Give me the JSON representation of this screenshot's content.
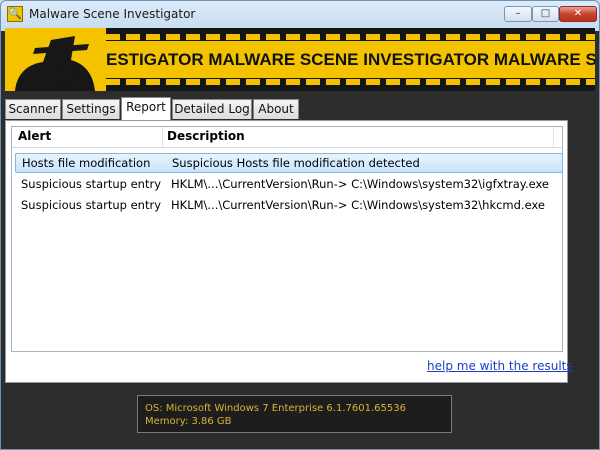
{
  "window": {
    "title": "Malware Scene Investigator",
    "icon": "magnifier-app-icon",
    "controls": {
      "minimize": "–",
      "maximize": "□",
      "close": "✕"
    }
  },
  "banner": {
    "text": "ESTIGATOR   MALWARE SCENE INVESTIGATOR   MALWARE SCENE INV",
    "accent_color": "#f3c300"
  },
  "tabs": [
    {
      "label": "Scanner"
    },
    {
      "label": "Settings"
    },
    {
      "label": "Report",
      "active": true
    },
    {
      "label": "Detailed Log"
    },
    {
      "label": "About"
    }
  ],
  "report": {
    "columns": {
      "alert": "Alert",
      "description": "Description"
    },
    "rows": [
      {
        "alert": "Hosts file modification",
        "description": "Suspicious Hosts file modification detected",
        "selected": true
      },
      {
        "alert": "Suspicious startup entry",
        "description": "HKLM\\...\\CurrentVersion\\Run-> C:\\Windows\\system32\\igfxtray.exe"
      },
      {
        "alert": "Suspicious startup entry",
        "description": "HKLM\\...\\CurrentVersion\\Run-> C:\\Windows\\system32\\hkcmd.exe"
      }
    ],
    "help_link": "help me with the results"
  },
  "status": {
    "os": "OS: Microsoft Windows 7 Enterprise  6.1.7601.65536",
    "memory": "Memory: 3.86 GB"
  }
}
